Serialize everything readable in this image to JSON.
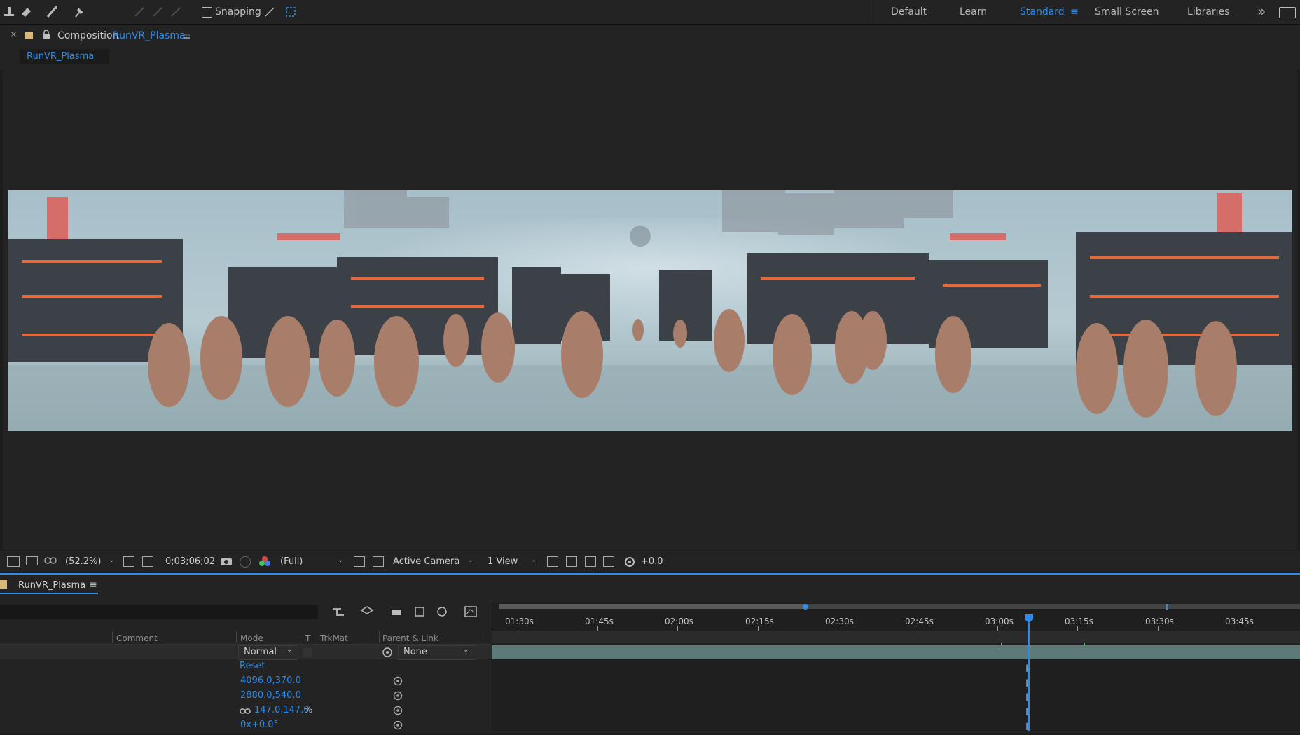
{
  "toolbar": {
    "snapping_label": "Snapping",
    "workspaces": [
      "Default",
      "Learn",
      "Standard",
      "Small Screen",
      "Libraries"
    ],
    "active_workspace": "Standard",
    "overflow_glyph": "»"
  },
  "composition": {
    "panel_prefix": "Composition",
    "name": "RunVR_Plasma",
    "tab_label": "RunVR_Plasma"
  },
  "viewer_bar": {
    "zoom": "(52.2%)",
    "timecode": "0;03;06;02",
    "resolution": "(Full)",
    "camera": "Active Camera",
    "views": "1 View",
    "exposure": "+0.0"
  },
  "timeline": {
    "tab_label": "RunVR_Plasma",
    "columns": {
      "comment": "Comment",
      "mode": "Mode",
      "t": "T",
      "trkmat": "TrkMat",
      "parent": "Parent & Link"
    },
    "layer": {
      "mode": "Normal",
      "parent": "None"
    },
    "properties": {
      "reset": "Reset",
      "anchor": "4096.0,370.0",
      "position": "2880.0,540.0",
      "scale": "147.0,147.0",
      "scale_unit": "%",
      "rotation": "0x+0.0°"
    },
    "ruler_ticks": [
      "01:30s",
      "01:45s",
      "02:00s",
      "02:15s",
      "02:30s",
      "02:45s",
      "03:00s",
      "03:15s",
      "03:30s",
      "03:45s"
    ]
  },
  "colors": {
    "accent": "#2d8ceb",
    "panel": "#232323",
    "track": "#5e7a78"
  },
  "icons": [
    "stamp-icon",
    "eraser-icon",
    "roto-brush-icon",
    "puppet-pin-icon",
    "snapping-checkbox",
    "menu-icon",
    "lock-icon",
    "camera-icon",
    "color-channel-icon",
    "exposure-reset-icon",
    "parent-pickwhip-icon",
    "link-icon"
  ]
}
